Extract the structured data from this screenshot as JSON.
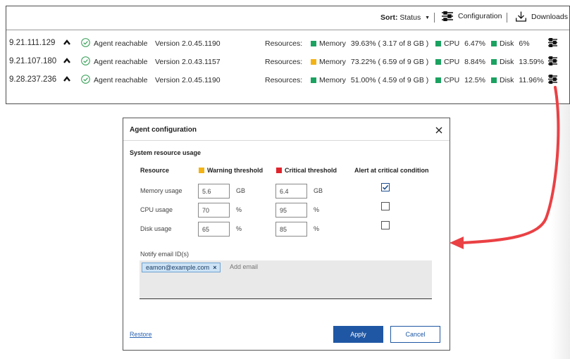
{
  "toolbar": {
    "sort_label": "Sort:",
    "sort_value": "Status",
    "configuration_label": "Configuration",
    "downloads_label": "Downloads"
  },
  "agents": [
    {
      "ip": "9.21.111.129",
      "status": "Agent reachable",
      "version": "Version  2.0.45.1190",
      "resources_label": "Resources:",
      "memory_label": "Memory",
      "memory_value": "39.63% ( 3.17 of 8 GB )",
      "memory_color": "#1aa260",
      "cpu_label": "CPU",
      "cpu_value": "6.47%",
      "cpu_color": "#1aa260",
      "disk_label": "Disk",
      "disk_value": "6%",
      "disk_color": "#1aa260"
    },
    {
      "ip": "9.21.107.180",
      "status": "Agent reachable",
      "version": "Version  2.0.43.1157",
      "resources_label": "Resources:",
      "memory_label": "Memory",
      "memory_value": "73.22% ( 6.59 of 9 GB )",
      "memory_color": "#f3b315",
      "cpu_label": "CPU",
      "cpu_value": "8.84%",
      "cpu_color": "#1aa260",
      "disk_label": "Disk",
      "disk_value": "13.59%",
      "disk_color": "#1aa260"
    },
    {
      "ip": "9.28.237.236",
      "status": "Agent reachable",
      "version": "Version  2.0.45.1190",
      "resources_label": "Resources:",
      "memory_label": "Memory",
      "memory_value": "51.00% ( 4.59 of 9 GB )",
      "memory_color": "#1aa260",
      "cpu_label": "CPU",
      "cpu_value": "12.5%",
      "cpu_color": "#1aa260",
      "disk_label": "Disk",
      "disk_value": "11.96%",
      "disk_color": "#1aa260"
    }
  ],
  "modal": {
    "title": "Agent configuration",
    "section_title": "System resource usage",
    "col_resource": "Resource",
    "col_warning": "Warning threshold",
    "col_critical": "Critical threshold",
    "col_alert": "Alert at critical condition",
    "warning_color": "#f3b315",
    "critical_color": "#e0242c",
    "rows": [
      {
        "label": "Memory usage",
        "warning": "5.6",
        "warning_unit": "GB",
        "critical": "6.4",
        "critical_unit": "GB",
        "alert": true
      },
      {
        "label": "CPU usage",
        "warning": "70",
        "warning_unit": "%",
        "critical": "95",
        "critical_unit": "%",
        "alert": false
      },
      {
        "label": "Disk usage",
        "warning": "65",
        "warning_unit": "%",
        "critical": "85",
        "critical_unit": "%",
        "alert": false
      }
    ],
    "notify_label": "Notify email ID(s)",
    "email_chip": "eamon@example.com",
    "add_email_placeholder": "Add email",
    "restore_label": "Restore",
    "apply_label": "Apply",
    "cancel_label": "Cancel"
  },
  "icons": {
    "status_ok": "check-circle-icon",
    "expand": "chevron-up-icon",
    "configure": "sliders-icon",
    "download": "download-icon",
    "close": "close-icon",
    "arrow": "curved-arrow-icon"
  },
  "arrow_color": "#ea4145"
}
